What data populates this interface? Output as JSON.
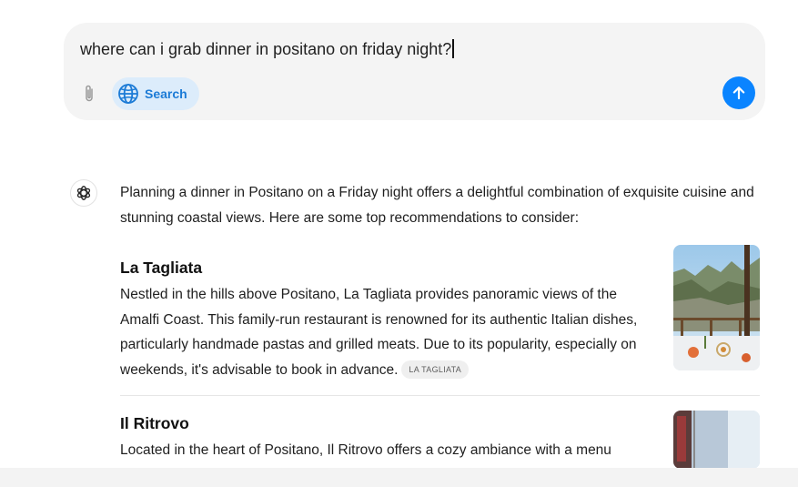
{
  "composer": {
    "input_text": "where can i grab dinner in positano on friday night?",
    "search_label": "Search",
    "icons": {
      "attach": "paperclip-icon",
      "search": "globe-icon",
      "send": "arrow-up-icon"
    },
    "accent_color": "#0a84ff",
    "chip_background": "#dcecfb"
  },
  "response": {
    "avatar_icon": "assistant-logo-icon",
    "intro": "Planning a dinner in Positano on a Friday night offers a delightful combination of exquisite cuisine and stunning coastal views. Here are some top recommendations to consider:",
    "recommendations": [
      {
        "name": "La Tagliata",
        "description": "Nestled in the hills above Positano, La Tagliata provides panoramic views of the Amalfi Coast. This family-run restaurant is renowned for its authentic Italian dishes, particularly handmade pastas and grilled meats. Due to its popularity, especially on weekends, it's advisable to book in advance.",
        "source": "LA TAGLIATA"
      },
      {
        "name": "Il Ritrovo",
        "description": "Located in the heart of Positano, Il Ritrovo offers a cozy ambiance with a menu"
      }
    ]
  }
}
